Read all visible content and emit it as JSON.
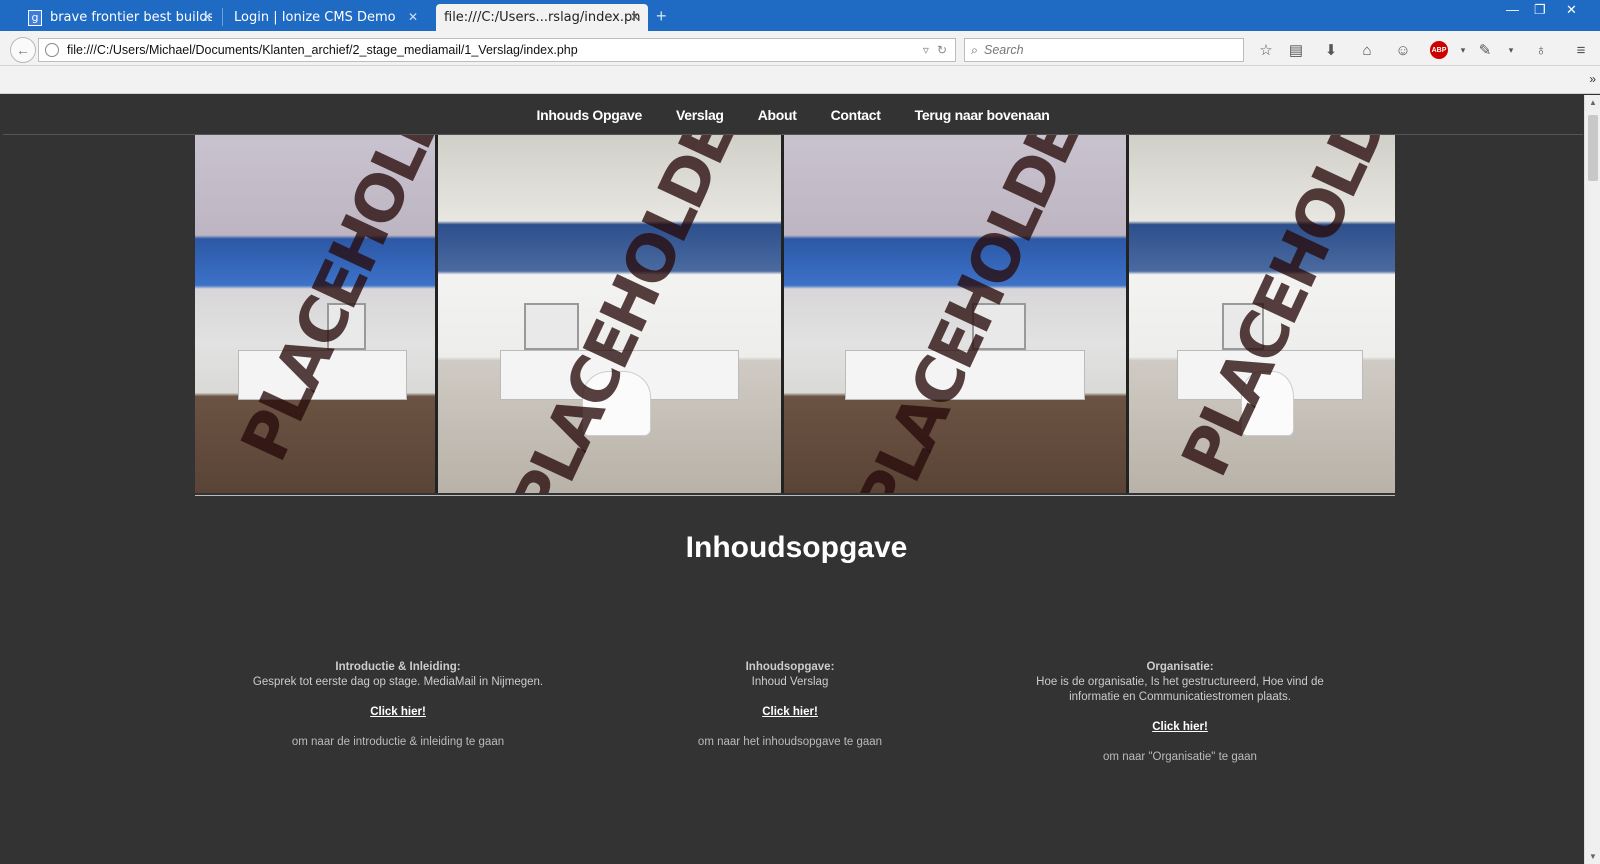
{
  "browser": {
    "tabs": [
      {
        "label": "brave frontier best builds - ...",
        "icon": "google-icon",
        "active": false
      },
      {
        "label": "Login | Ionize CMS Demo",
        "icon": "",
        "active": false
      },
      {
        "label": "file:///C:/Users...rslag/index.php",
        "icon": "",
        "active": true
      }
    ],
    "url": "file:///C:/Users/Michael/Documents/Klanten_archief/2_stage_mediamail/1_Verslag/index.php",
    "search_placeholder": "Search",
    "abp_label": "ABP"
  },
  "site": {
    "nav": [
      "Inhouds Opgave",
      "Verslag",
      "About",
      "Contact",
      "Terug naar bovenaan"
    ],
    "gallery_watermark": "PLACEHOLDER",
    "heading": "Inhoudsopgave",
    "columns": [
      {
        "title": "Introductie & Inleiding:",
        "text": "Gesprek tot eerste dag op stage. MediaMail in Nijmegen.",
        "link": "Click hier!",
        "note": "om naar de introductie & inleiding te gaan"
      },
      {
        "title": "Inhoudsopgave:",
        "text": "Inhoud Verslag",
        "link": "Click hier!",
        "note": "om naar het inhoudsopgave te gaan"
      },
      {
        "title": "Organisatie:",
        "text": "Hoe is de organisatie, Is het gestructureerd, Hoe vind de informatie en Communicatiestromen plaats.",
        "link": "Click hier!",
        "note": "om naar \"Organisatie\" te gaan"
      }
    ]
  }
}
